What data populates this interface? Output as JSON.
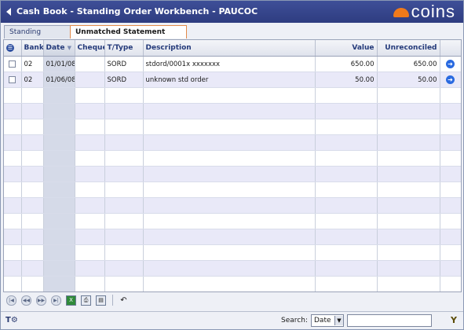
{
  "window": {
    "title": "Cash Book - Standing Order Workbench - PAUCOC",
    "logo_text": "COINS"
  },
  "tabs": [
    {
      "label": "Standing Orders"
    },
    {
      "label": "Unmatched Statement Items"
    }
  ],
  "columns": {
    "bank": "Bank",
    "date": "Date",
    "cheque": "Cheque",
    "ttype": "T/Type",
    "description": "Description",
    "value": "Value",
    "unreconciled": "Unreconciled"
  },
  "rows": [
    {
      "bank": "02",
      "date": "01/01/08",
      "cheque": "",
      "ttype": "SORD",
      "description": "stdord/0001x xxxxxxx",
      "value": "650.00",
      "unreconciled": "650.00"
    },
    {
      "bank": "02",
      "date": "01/06/08",
      "cheque": "",
      "ttype": "SORD",
      "description": "unknown std order",
      "value": "50.00",
      "unreconciled": "50.00"
    }
  ],
  "search": {
    "label": "Search:",
    "field": "Date",
    "value": ""
  },
  "colors": {
    "titlebar": "#2e3c80",
    "accent": "#f07a1a",
    "rowAlt": "#e9e9f8"
  }
}
